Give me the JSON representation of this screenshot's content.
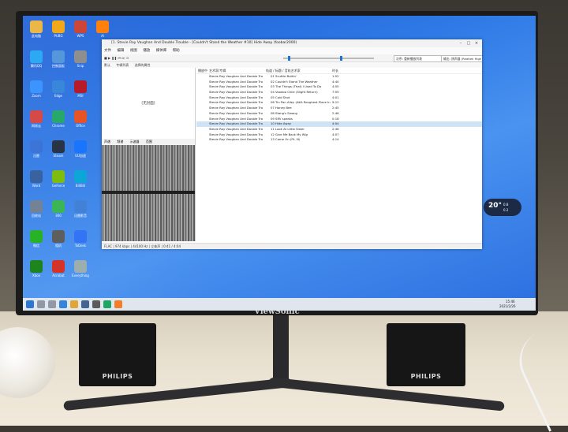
{
  "colors": {
    "desktop": "#2f7ae6",
    "window": "#ffffff",
    "accent": "#1a73d9",
    "taskbar": "#dfe6ee"
  },
  "monitor_brand": "ViewSonic",
  "speaker_brand": "PHILIPS",
  "player": {
    "title": "[1. Stevie Ray Vaughan And Double Trouble - [Couldn't Stand the Weather #10] Hide Away (foobar2000)",
    "menu": [
      "文件",
      "编辑",
      "视图",
      "播放",
      "媒体库",
      "帮助"
    ],
    "tabs": [
      "默认",
      "专辑列表",
      "选择的属性"
    ],
    "output_label": "输出: 扬声器 (Realtek High Definition Audio)",
    "art_placeholder": "[无封面]",
    "left_tabs": [
      "声谱",
      "频谱",
      "示波器",
      "范围"
    ],
    "columns": {
      "playing": "播放中",
      "artist": "艺术家/专辑",
      "track": "轨道 / 标题 / 音轨艺术家",
      "duration": "时长"
    },
    "tracks": [
      {
        "num": "01",
        "title": "Scuttle Buttin'",
        "duration": "1:52"
      },
      {
        "num": "02",
        "title": "Couldn't Stand The Weather",
        "duration": "4:40"
      },
      {
        "num": "03",
        "title": "The Things (That) I Used To Do",
        "duration": "4:55"
      },
      {
        "num": "04",
        "title": "Voodoo Chile (Slight Return)",
        "duration": "7:59"
      },
      {
        "num": "05",
        "title": "Cold Shot",
        "duration": "4:01"
      },
      {
        "num": "06",
        "title": "Tin Pan Alley (AKA Roughest Place In Town)",
        "duration": "9:12"
      },
      {
        "num": "07",
        "title": "Honey Bee",
        "duration": "2:45"
      },
      {
        "num": "08",
        "title": "Stang's Swang",
        "duration": "2:46"
      },
      {
        "num": "09",
        "title": "SRV speaks",
        "duration": "0:18"
      },
      {
        "num": "10",
        "title": "Hide Away",
        "duration": "4:04"
      },
      {
        "num": "11",
        "title": "Look At Little Sister",
        "duration": "2:46"
      },
      {
        "num": "12",
        "title": "Give Me Back My Wig",
        "duration": "4:07"
      },
      {
        "num": "13",
        "title": "Come On (Pt. III)",
        "duration": "4:14"
      }
    ],
    "artist_cell": "Stevie Ray Vaughan And Double Trouble",
    "selected_index": 9,
    "status": "FLAC | 974 kbps | 44100 Hz | 立体声 | 0:41 / 4:04"
  },
  "desktop_icons": [
    "此电脑",
    "腾讯QQ",
    "Zoom",
    "网易云",
    "迅雷",
    "Word",
    "回收站",
    "微信",
    "Xbox",
    "PUBG",
    "控制面板",
    "Edge",
    "Chrome",
    "Steam",
    "GeForce",
    "360",
    "相机",
    "Acrobat",
    "WPS",
    "Snip",
    "MSI",
    "Office",
    "UU加速",
    "BiliBili",
    "迅雷影音",
    "ToDesk",
    "Everything",
    "Ai"
  ],
  "widget": {
    "temp": "20°",
    "line1": "0.8",
    "line2": "0.2"
  },
  "taskbar": {
    "time": "15:46",
    "date": "2021/2/26"
  }
}
